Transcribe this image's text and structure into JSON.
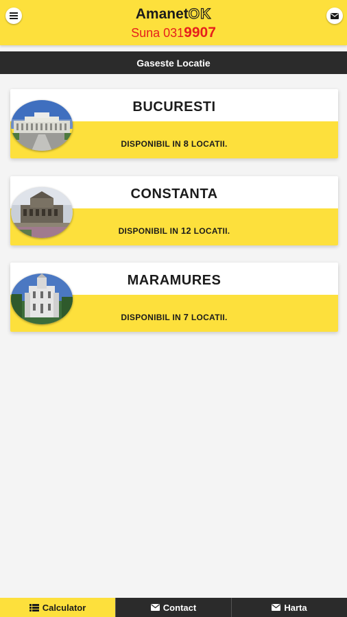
{
  "header": {
    "brand_main": "Amanet",
    "brand_ok": "OK",
    "phone_prefix": "Suna 031",
    "phone_bold": "9907",
    "menu_icon": "hamburger-icon",
    "mail_icon": "envelope-icon"
  },
  "title_bar": {
    "label": "Gaseste Locatie"
  },
  "locations": [
    {
      "city": "BUCURESTI",
      "avail_prefix": "DISPONIBIL IN ",
      "count": "8",
      "avail_suffix": " LOCATII",
      "period": "."
    },
    {
      "city": "CONSTANTA",
      "avail_prefix": "DISPONIBIL IN ",
      "count": "12",
      "avail_suffix": " LOCATII",
      "period": "."
    },
    {
      "city": "MARAMURES",
      "avail_prefix": "DISPONIBIL IN ",
      "count": "7",
      "avail_suffix": " LOCATII",
      "period": "."
    }
  ],
  "bottom_nav": {
    "tabs": [
      {
        "label": "Calculator",
        "icon": "list-icon",
        "active": true
      },
      {
        "label": "Contact",
        "icon": "envelope-icon",
        "active": false
      },
      {
        "label": "Harta",
        "icon": "envelope-icon",
        "active": false
      }
    ]
  },
  "colors": {
    "accent_yellow": "#fde03c",
    "dark": "#2b2b2b",
    "phone_red": "#e6201c"
  }
}
